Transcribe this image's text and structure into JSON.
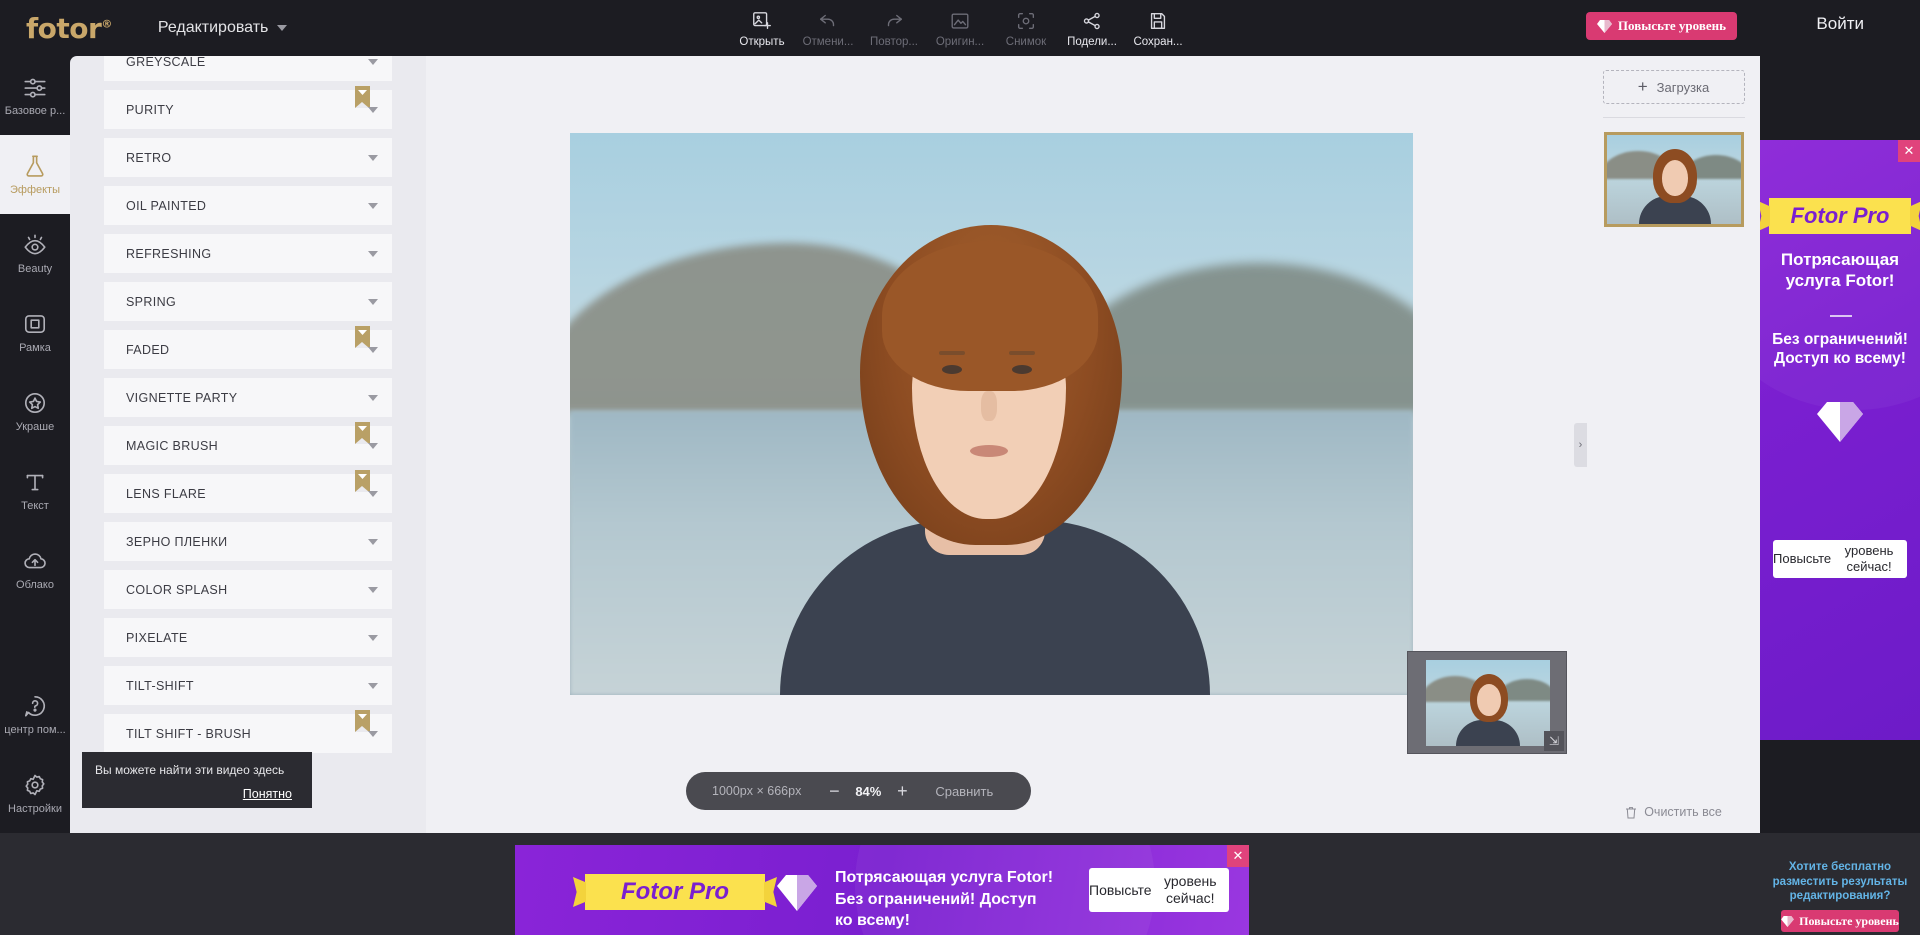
{
  "app": {
    "logo": "fotor",
    "logo_reg": "®",
    "menu_edit": "Редактировать",
    "signin": "Войти",
    "upgrade_button": "Повысьте уровень",
    "accent_pink": "#d93a72",
    "accent_gold": "#c9a76a",
    "accent_purple": "#7a1fd0"
  },
  "toolbar": [
    {
      "label": "Открыть",
      "icon": "open-image-icon",
      "state": "active"
    },
    {
      "label": "Отмени...",
      "icon": "undo-icon",
      "state": "dim"
    },
    {
      "label": "Повтор...",
      "icon": "redo-icon",
      "state": "dim"
    },
    {
      "label": "Оригин...",
      "icon": "original-image-icon",
      "state": "dim"
    },
    {
      "label": "Снимок",
      "icon": "snapshot-icon",
      "state": "dim"
    },
    {
      "label": "Подели...",
      "icon": "share-icon",
      "state": "active"
    },
    {
      "label": "Сохран...",
      "icon": "save-icon",
      "state": "active"
    }
  ],
  "rail": {
    "items": [
      {
        "label": "Базовое р...",
        "icon": "sliders-icon",
        "selected": false
      },
      {
        "label": "Эффекты",
        "icon": "flask-icon",
        "selected": true
      },
      {
        "label": "Beauty",
        "icon": "eye-icon",
        "selected": false
      },
      {
        "label": "Рамка",
        "icon": "frame-icon",
        "selected": false
      },
      {
        "label": "Украше",
        "icon": "star-badge-icon",
        "selected": false
      },
      {
        "label": "Текст",
        "icon": "text-t-icon",
        "selected": false
      },
      {
        "label": "Облако",
        "icon": "cloud-upload-icon",
        "selected": false
      }
    ],
    "bottom": [
      {
        "label": "центр пом...",
        "icon": "help-question-icon"
      },
      {
        "label": "Настройки",
        "icon": "gear-icon"
      }
    ]
  },
  "effects": {
    "rows": [
      {
        "name": "GREYSCALE",
        "pro": false
      },
      {
        "name": "PURITY",
        "pro": true
      },
      {
        "name": "RETRO",
        "pro": false
      },
      {
        "name": "OIL PAINTED",
        "pro": false
      },
      {
        "name": "REFRESHING",
        "pro": false
      },
      {
        "name": "SPRING",
        "pro": false
      },
      {
        "name": "FADED",
        "pro": true
      },
      {
        "name": "VIGNETTE PARTY",
        "pro": false
      },
      {
        "name": "MAGIC BRUSH",
        "pro": true
      },
      {
        "name": "LENS FLARE",
        "pro": true
      },
      {
        "name": "ЗЕРНО ПЛЕНКИ",
        "pro": false
      },
      {
        "name": "COLOR SPLASH",
        "pro": false
      },
      {
        "name": "PIXELATE",
        "pro": false
      },
      {
        "name": "TILT-SHIFT",
        "pro": false
      },
      {
        "name": "TILT SHIFT - BRUSH",
        "pro": true
      }
    ]
  },
  "tooltip": {
    "text": "Вы можете найти эти видео здесь",
    "action": "Понятно"
  },
  "canvas": {
    "zoombar": {
      "dimensions": "1000px × 666px",
      "minus": "−",
      "zoom_level": "84%",
      "plus": "+",
      "compare": "Сравнить"
    },
    "minimap_grip": "⇲",
    "collapse_handle": "›"
  },
  "right_panel": {
    "upload": "Загрузка",
    "upload_plus": "+",
    "clear_all": "Очистить все",
    "clear_icon": "trash-icon"
  },
  "side_ad": {
    "close": "✕",
    "brand": "Fotor Pro",
    "headline": "Потрясающая\nуслуга Fotor!",
    "subhead": "Без ограничений!\nДоступ ко всему!",
    "cta": "Повысьте\nуровень сейчас!",
    "gem_icon": "diamond-icon"
  },
  "promo": {
    "text": "Хотите бесплатно\nразместить результаты\nредактирования?",
    "button": "Повысьте уровень"
  },
  "bottom_ad": {
    "close": "✕",
    "brand": "Fotor Pro",
    "line1": "Потрясающая услуга Fotor!",
    "line2": "Без ограничений! Доступ",
    "line3": "ко всему!",
    "cta": "Повысьте\nуровень сейчас!",
    "gem_icon": "diamond-icon"
  }
}
